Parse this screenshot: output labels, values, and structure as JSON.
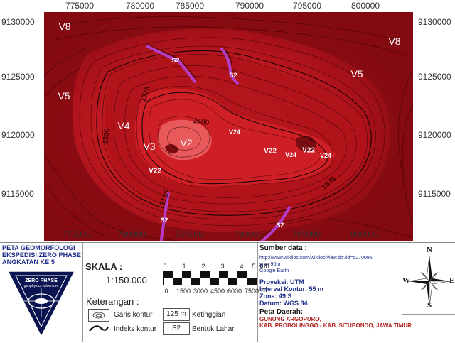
{
  "map": {
    "x_ticks": [
      "775000",
      "780000",
      "785000",
      "790000",
      "795000",
      "800000"
    ],
    "y_ticks": [
      "9130000",
      "9125000",
      "9120000",
      "9115000"
    ],
    "zones": [
      {
        "label": "V8",
        "size": "normal"
      },
      {
        "label": "V8",
        "size": "normal"
      },
      {
        "label": "V5",
        "size": "normal"
      },
      {
        "label": "V5",
        "size": "normal"
      },
      {
        "label": "V4",
        "size": "normal"
      },
      {
        "label": "V3",
        "size": "normal"
      },
      {
        "label": "V2",
        "size": "normal"
      },
      {
        "label": "V22",
        "size": "mid"
      },
      {
        "label": "V22",
        "size": "mid"
      },
      {
        "label": "V22",
        "size": "mid"
      },
      {
        "label": "V24",
        "size": "small"
      },
      {
        "label": "V24",
        "size": "small"
      },
      {
        "label": "V24",
        "size": "small"
      },
      {
        "label": "S2",
        "size": "small"
      },
      {
        "label": "S2",
        "size": "small"
      },
      {
        "label": "S2",
        "size": "small"
      },
      {
        "label": "S2",
        "size": "small"
      }
    ],
    "contour_labels": [
      "2400",
      "1575",
      "1300",
      "2125",
      "1575"
    ],
    "colors": {
      "low": "#8e0a10",
      "mid": "#b8141c",
      "high": "#d8242c",
      "peak": "#ee6a6a",
      "river": "#b43cc8",
      "contour": "#2a0000"
    }
  },
  "title": {
    "lines": [
      "PETA GEOMORFOLOGI",
      "EKSPEDISI ZERO PHASE",
      "ANGKATAN KE 5"
    ],
    "logo_text": "ZERO PHASE",
    "logo_sub": "geophysics adventure"
  },
  "scale": {
    "label": "SKALA :",
    "value": "1:150.000",
    "cm_ticks": [
      "0",
      "1",
      "2",
      "3",
      "4",
      "5"
    ],
    "cm_unit": "cm",
    "m_ticks": [
      "0",
      "1500",
      "3000",
      "4500",
      "6000",
      "7500"
    ],
    "m_unit": "m"
  },
  "legend": {
    "title": "Keterangan :",
    "garis_kontur": "Garis kontur",
    "indeks_kontur": "Indeks kontur",
    "elev_box": "125 m",
    "elev_label": "Ketinggian",
    "landform_box": "S2",
    "landform_label": "Bentuk Lahan"
  },
  "source": {
    "heading": "Sumber data :",
    "lines": [
      "http://www.wikiloc.com/wikiloc/view.do?id=5270095",
      "srtm 90m",
      "Google Earth"
    ],
    "proj": [
      "Proyeksi: UTM",
      "Interval Kontur: 55 m",
      "Zone: 49 S",
      "Datum: WGS 84"
    ],
    "area_heading": "Peta Daerah:",
    "area": [
      "GUNUNG ARGOPURO,",
      "KAB. PROBOLINGGO - KAB. SITUBONDO, JAWA TIMUR"
    ]
  },
  "compass": {
    "n": "N",
    "s": "S",
    "e": "E",
    "w": "W"
  }
}
